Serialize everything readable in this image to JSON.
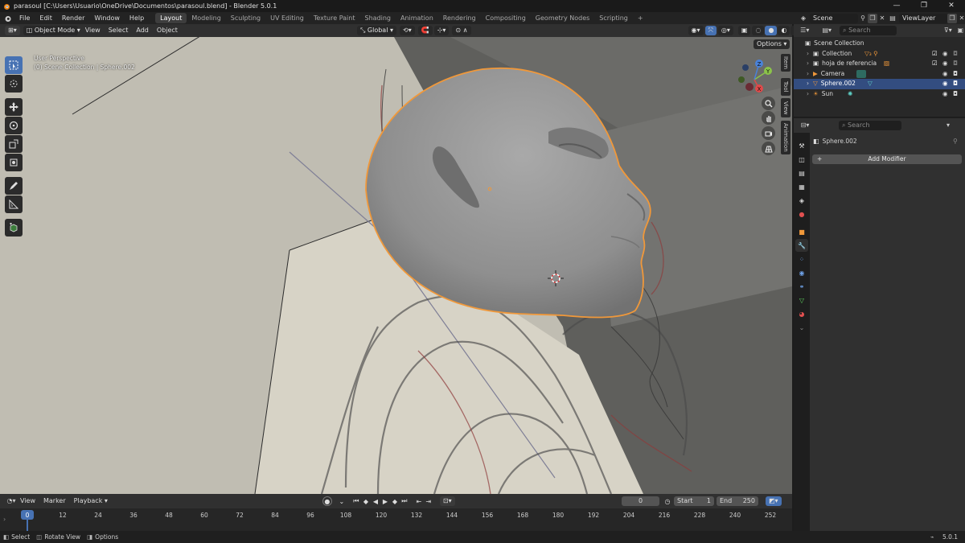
{
  "window": {
    "title": "parasoul [C:\\Users\\Usuario\\OneDrive\\Documentos\\parasoul.blend] - Blender 5.0.1",
    "controls": [
      "—",
      "❐",
      "✕"
    ]
  },
  "menus": [
    "File",
    "Edit",
    "Render",
    "Window",
    "Help"
  ],
  "workspaces": [
    {
      "label": "Layout",
      "active": true
    },
    {
      "label": "Modeling",
      "active": false
    },
    {
      "label": "Sculpting",
      "active": false
    },
    {
      "label": "UV Editing",
      "active": false
    },
    {
      "label": "Texture Paint",
      "active": false
    },
    {
      "label": "Shading",
      "active": false
    },
    {
      "label": "Animation",
      "active": false
    },
    {
      "label": "Rendering",
      "active": false
    },
    {
      "label": "Compositing",
      "active": false
    },
    {
      "label": "Geometry Nodes",
      "active": false
    },
    {
      "label": "Scripting",
      "active": false
    }
  ],
  "add_workspace": "+",
  "scene_field": "Scene",
  "viewlayer_field": "ViewLayer",
  "viewport_header": {
    "mode": "Object Mode",
    "menus": [
      "View",
      "Select",
      "Add",
      "Object"
    ],
    "orientation": "Global",
    "options_label": "Options"
  },
  "viewport": {
    "perspective": "User Perspective",
    "context": "(0) Scene Collection | Sphere.002"
  },
  "side_tabs": [
    "Item",
    "Tool",
    "View",
    "Animation"
  ],
  "gizmo": {
    "x": "X",
    "y": "Y",
    "z": "Z"
  },
  "outliner": {
    "search_placeholder": "Search",
    "root": "Scene Collection",
    "items": [
      {
        "name": "Collection",
        "selected": false
      },
      {
        "name": "hoja de referencia",
        "selected": false
      },
      {
        "name": "Camera",
        "selected": false
      },
      {
        "name": "Sphere.002",
        "selected": true
      },
      {
        "name": "Sun",
        "selected": false
      }
    ]
  },
  "properties": {
    "search_placeholder": "Search",
    "object_name": "Sphere.002",
    "add_modifier": "Add Modifier"
  },
  "timeline": {
    "menus": [
      "View",
      "Marker",
      "Playback"
    ],
    "current_frame": "0",
    "start_label": "Start",
    "start_value": "1",
    "end_label": "End",
    "end_value": "250",
    "ticks": [
      "0",
      "12",
      "24",
      "36",
      "48",
      "60",
      "72",
      "84",
      "96",
      "108",
      "120",
      "132",
      "144",
      "156",
      "168",
      "180",
      "192",
      "204",
      "216",
      "228",
      "240",
      "252"
    ]
  },
  "statusbar": {
    "select": "Select",
    "rotate": "Rotate View",
    "options": "Options",
    "version": "5.0.1"
  },
  "colors": {
    "accent": "#4772b3",
    "selection_outline": "#f0983a",
    "bg_dark": "#1d1d1d"
  }
}
